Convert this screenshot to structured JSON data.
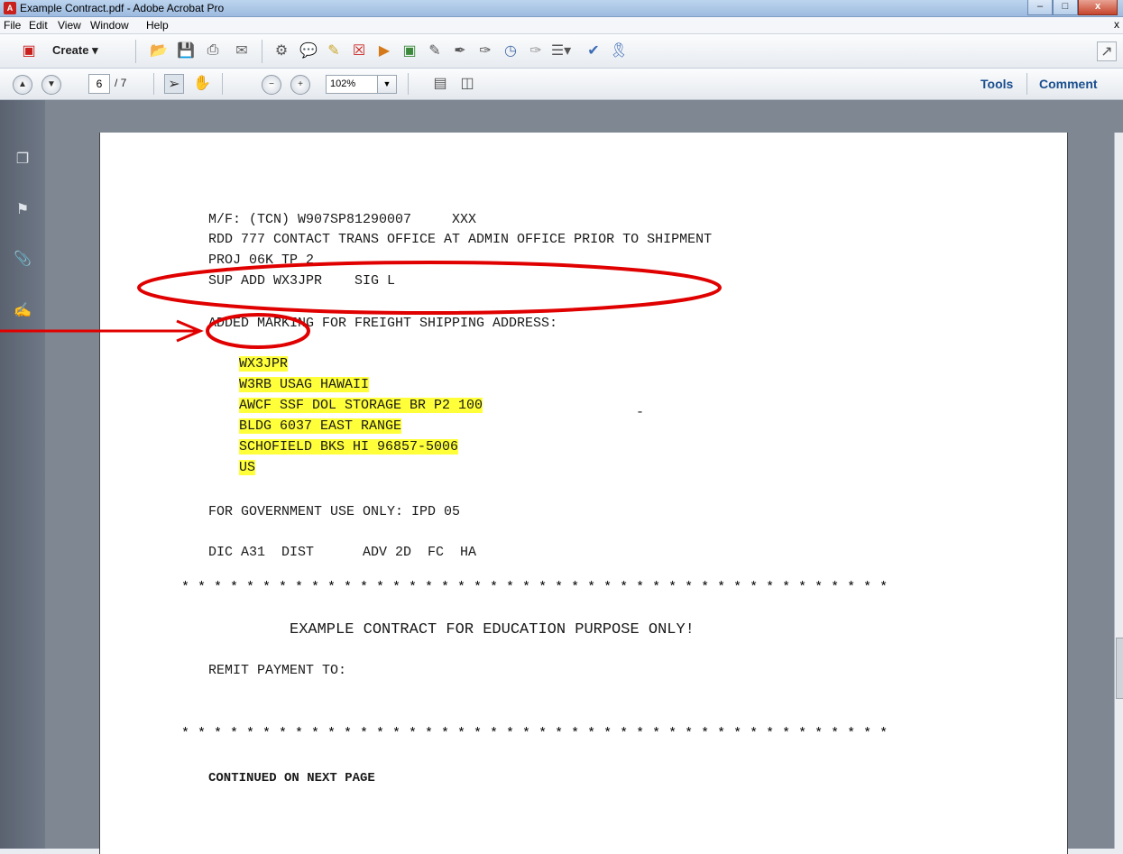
{
  "window": {
    "title": "Example Contract.pdf - Adobe Acrobat Pro",
    "minimize": "–",
    "maximize": "□",
    "close": "x"
  },
  "menu": {
    "file": "File",
    "edit": "Edit",
    "view": "View",
    "window": "Window",
    "help": "Help",
    "close_doc": "x"
  },
  "toolbar": {
    "create_label": "Create",
    "page_current": "6",
    "page_total": "/ 7",
    "zoom": "102%",
    "tools": "Tools",
    "comment": "Comment"
  },
  "document": {
    "lines": [
      "M/F: (TCN) W907SP81290007     XXX",
      "RDD 777 CONTACT TRANS OFFICE AT ADMIN OFFICE PRIOR TO SHIPMENT",
      "PROJ 06K TP 2",
      "SUP ADD WX3JPR    SIG L"
    ],
    "added_marking": "ADDED MARKING FOR FREIGHT SHIPPING ADDRESS:",
    "address": [
      "WX3JPR",
      "W3RB USAG HAWAII",
      "AWCF SSF DOL STORAGE BR P2 100",
      "BLDG 6037 EAST RANGE",
      "SCHOFIELD BKS HI 96857-5006",
      "US"
    ],
    "dash_mark": "-",
    "gov_use": "FOR GOVERNMENT USE ONLY: IPD 05",
    "dic_line": "DIC A31  DIST      ADV 2D  FC  HA",
    "stars": "* * * * * * * * * * * * * * * * * * * * * * * * * * * * * * * * * * * * * * * * * * * *",
    "education_notice": "EXAMPLE CONTRACT FOR EDUCATION PURPOSE ONLY!",
    "remit": "REMIT PAYMENT TO:",
    "continued": "CONTINUED ON NEXT PAGE"
  },
  "colors": {
    "highlight": "#ffff3a",
    "annotation": "#e00000",
    "link": "#1b4f8f"
  }
}
